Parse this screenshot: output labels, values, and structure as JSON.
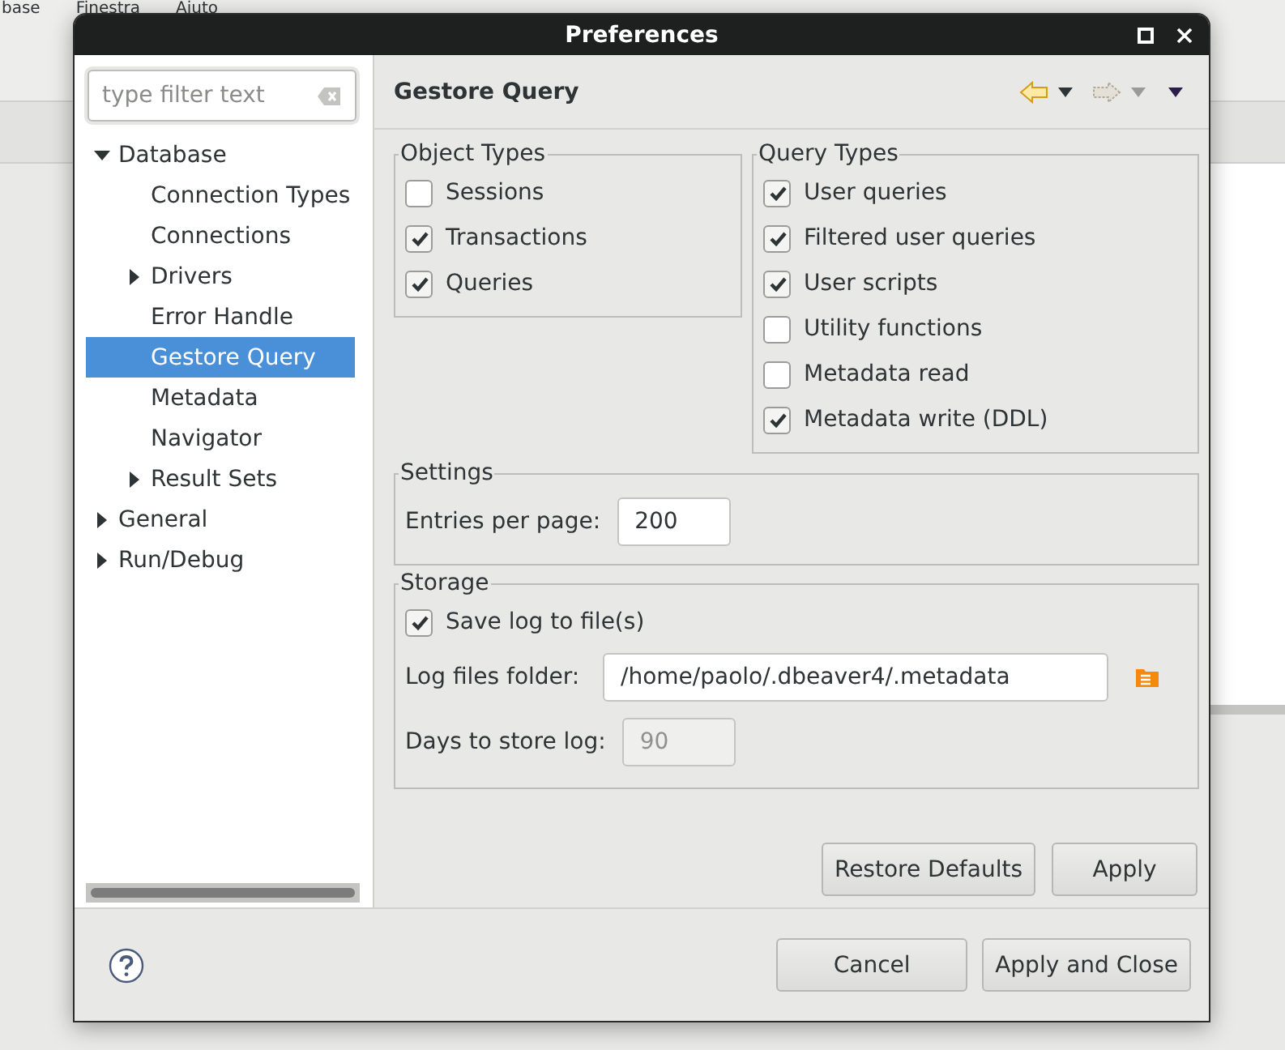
{
  "background_menu": [
    "base",
    "Finestra",
    "Aiuto"
  ],
  "window": {
    "title": "Preferences"
  },
  "filter": {
    "placeholder": "type filter text"
  },
  "tree": [
    {
      "label": "Database",
      "kind": "branch",
      "expanded": true,
      "selected": false,
      "children": [
        {
          "label": "Connection Types",
          "kind": "leaf",
          "selected": false
        },
        {
          "label": "Connections",
          "kind": "leaf",
          "selected": false
        },
        {
          "label": "Drivers",
          "kind": "branch",
          "expanded": false,
          "selected": false
        },
        {
          "label": "Error Handle",
          "kind": "leaf",
          "selected": false
        },
        {
          "label": "Gestore Query",
          "kind": "leaf",
          "selected": true
        },
        {
          "label": "Metadata",
          "kind": "leaf",
          "selected": false
        },
        {
          "label": "Navigator",
          "kind": "leaf",
          "selected": false
        },
        {
          "label": "Result Sets",
          "kind": "branch",
          "expanded": false,
          "selected": false
        }
      ]
    },
    {
      "label": "General",
      "kind": "branch",
      "expanded": false,
      "selected": false
    },
    {
      "label": "Run/Debug",
      "kind": "branch",
      "expanded": false,
      "selected": false
    }
  ],
  "page": {
    "title": "Gestore Query",
    "nav": {
      "back_disabled": false,
      "forward_disabled": true
    }
  },
  "object_types": {
    "title": "Object Types",
    "items": [
      {
        "label": "Sessions",
        "checked": false
      },
      {
        "label": "Transactions",
        "checked": true
      },
      {
        "label": "Queries",
        "checked": true
      }
    ]
  },
  "query_types": {
    "title": "Query Types",
    "items": [
      {
        "label": "User queries",
        "checked": true
      },
      {
        "label": "Filtered user queries",
        "checked": true
      },
      {
        "label": "User scripts",
        "checked": true
      },
      {
        "label": "Utility functions",
        "checked": false
      },
      {
        "label": "Metadata read",
        "checked": false
      },
      {
        "label": "Metadata write (DDL)",
        "checked": true
      }
    ]
  },
  "settings": {
    "title": "Settings",
    "entries_label": "Entries per page:",
    "entries_value": "200"
  },
  "storage": {
    "title": "Storage",
    "save_log": {
      "label": "Save log to file(s)",
      "checked": true
    },
    "folder_label": "Log files folder:",
    "folder_value": "/home/paolo/.dbeaver4/.metadata",
    "days_label": "Days to store log:",
    "days_value": "90",
    "days_disabled": true
  },
  "page_buttons": [
    "Restore Defaults",
    "Apply"
  ],
  "dialog_buttons": [
    "Cancel",
    "Apply and Close"
  ]
}
